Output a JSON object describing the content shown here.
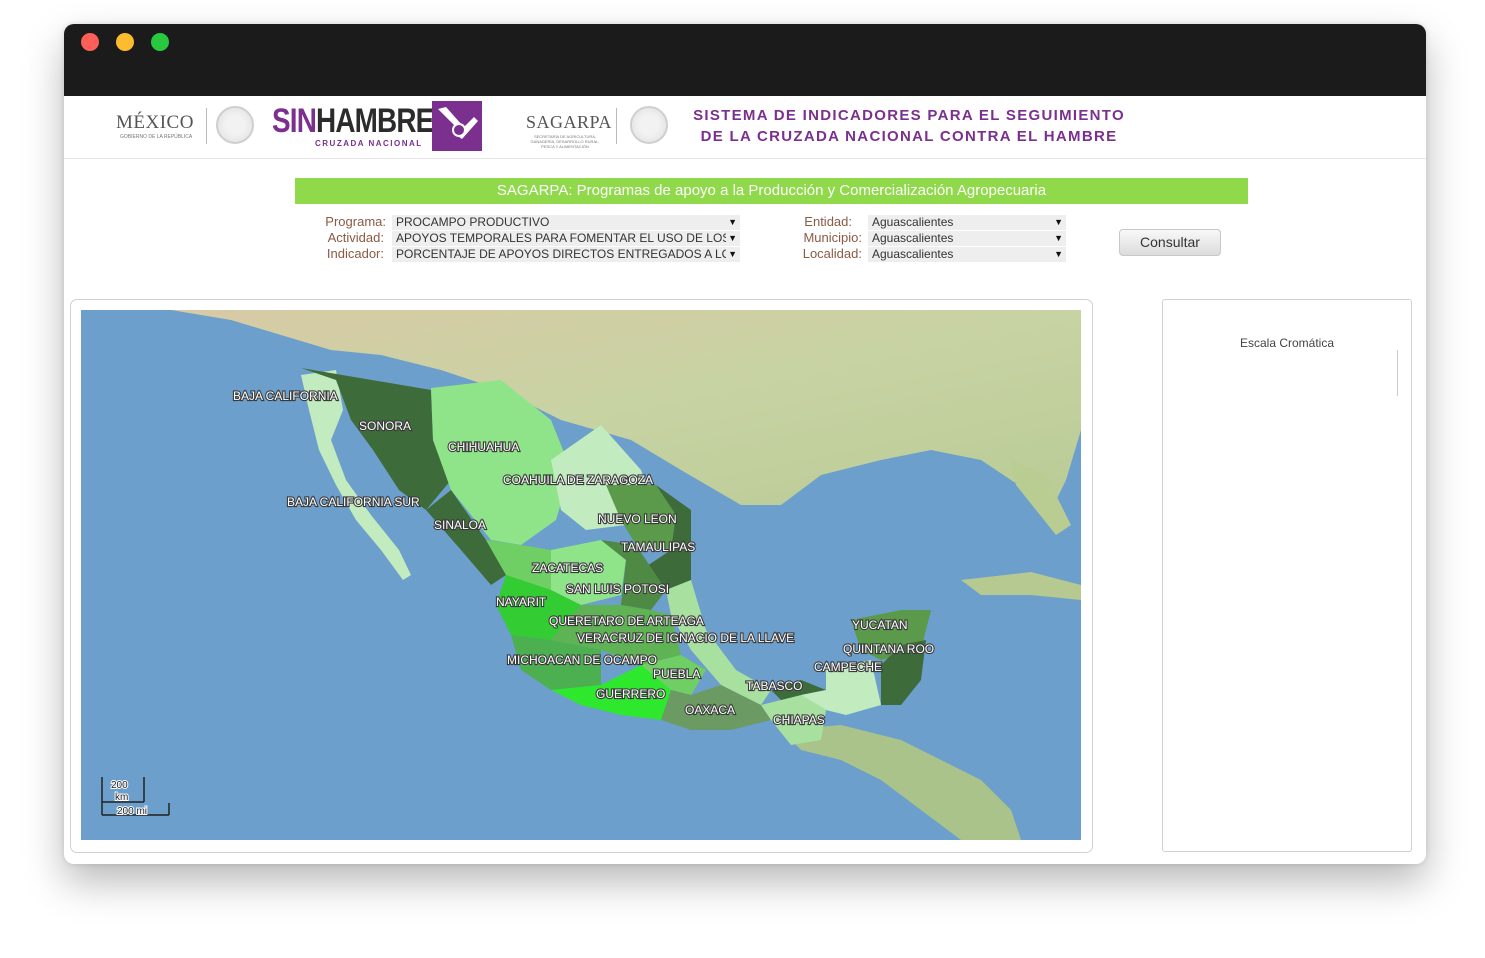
{
  "header": {
    "gov_logo": "MÉXICO",
    "gov_logo_sub": "GOBIERNO DE LA REPÚBLICA",
    "campaign_logo_part1": "SIN",
    "campaign_logo_part2": "HAMBRE",
    "campaign_logo_sub": "CRUZADA NACIONAL",
    "agency_logo": "SAGARPA",
    "agency_logo_sub": "SECRETARÍA DE AGRICULTURA, GANADERÍA, DESARROLLO RURAL, PESCA Y ALIMENTACIÓN",
    "system_title_line1": "SISTEMA DE INDICADORES PARA EL SEGUIMIENTO",
    "system_title_line2": "DE LA CRUZADA NACIONAL CONTRA EL HAMBRE"
  },
  "banner": "SAGARPA: Programas de apoyo a la Producción y Comercialización Agropecuaria",
  "filters": {
    "programa_label": "Programa:",
    "programa_value": "PROCAMPO PRODUCTIVO",
    "actividad_label": "Actividad:",
    "actividad_value": "APOYOS TEMPORALES PARA FOMENTAR EL USO DE LOS",
    "indicador_label": "Indicador:",
    "indicador_value": "PORCENTAJE DE APOYOS DIRECTOS ENTREGADOS A LO",
    "entidad_label": "Entidad:",
    "entidad_value": "Aguascalientes",
    "municipio_label": "Municipio:",
    "municipio_value": "Aguascalientes",
    "localidad_label": "Localidad:",
    "localidad_value": "Aguascalientes",
    "dropdown_arrow": "▼",
    "consultar_button": "Consultar"
  },
  "map": {
    "states": {
      "baja_california": "BAJA CALIFORNIA",
      "sonora": "SONORA",
      "chihuahua": "CHIHUAHUA",
      "coahuila": "COAHUILA DE ZARAGOZA",
      "baja_california_sur": "BAJA CALIFORNIA SUR",
      "nuevo_leon": "NUEVO LEON",
      "sinaloa": "SINALOA",
      "tamaulipas": "TAMAULIPAS",
      "zacatecas": "ZACATECAS",
      "san_luis_potosi": "SAN LUIS POTOSI",
      "nayarit": "NAYARIT",
      "queretaro": "QUERETARO DE ARTEAGA",
      "veracruz": "VERACRUZ DE IGNACIO DE LA LLAVE",
      "michoacan": "MICHOACAN DE OCAMPO",
      "puebla": "PUEBLA",
      "guerrero": "GUERRERO",
      "oaxaca": "OAXACA",
      "tabasco": "TABASCO",
      "chiapas": "CHIAPAS",
      "yucatan": "YUCATAN",
      "quintana_roo": "QUINTANA ROO",
      "campeche": "CAMPECHE"
    },
    "scale_km_value": "200",
    "scale_km_unit": "km",
    "scale_mi": "200 mi",
    "colors": {
      "ocean": "#6c9fcb",
      "land": "#c9d6a8",
      "dark_green": "#3e6b3a",
      "mid_green": "#5a9a4a",
      "light_green": "#8fe48a",
      "bright_green": "#33cc33",
      "pale_green": "#c2ebc0"
    }
  },
  "legend": {
    "title": "Escala Cromática"
  }
}
